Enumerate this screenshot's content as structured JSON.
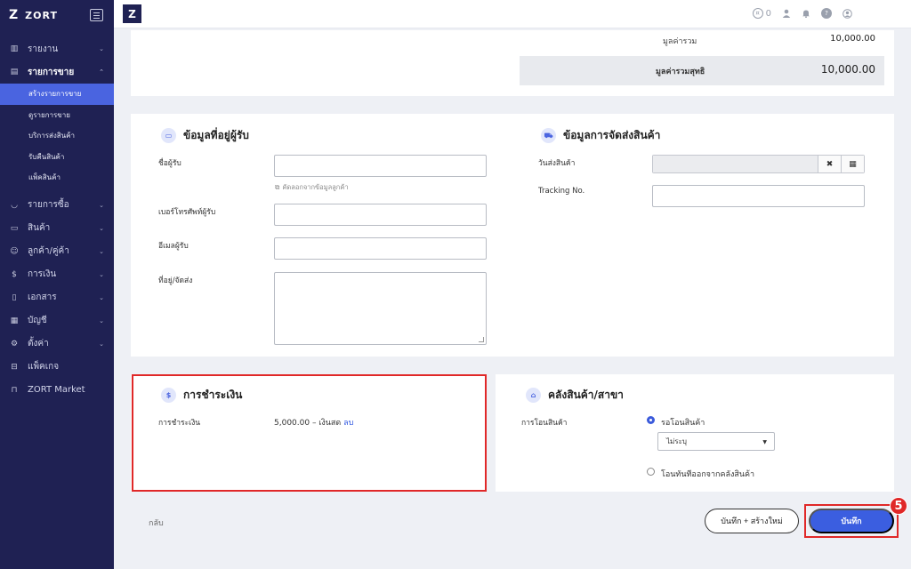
{
  "brand": {
    "logo": "Z",
    "name": "ZORT"
  },
  "sidebar": {
    "items": [
      {
        "label": "รายงาน",
        "icon": "bar-chart-icon",
        "glyph": "▥"
      },
      {
        "label": "รายการขาย",
        "icon": "clipboard-icon",
        "glyph": "▤"
      },
      {
        "label": "รายการซื้อ",
        "icon": "basket-icon",
        "glyph": "◡"
      },
      {
        "label": "สินค้า",
        "icon": "box-icon",
        "glyph": "▭"
      },
      {
        "label": "ลูกค้า/คู่ค้า",
        "icon": "users-icon",
        "glyph": "☺"
      },
      {
        "label": "การเงิน",
        "icon": "money-icon",
        "glyph": "$"
      },
      {
        "label": "เอกสาร",
        "icon": "document-icon",
        "glyph": "▯"
      },
      {
        "label": "บัญชี",
        "icon": "ledger-icon",
        "glyph": "▦"
      },
      {
        "label": "ตั้งค่า",
        "icon": "gear-icon",
        "glyph": "⚙"
      },
      {
        "label": "แพ็คเกจ",
        "icon": "briefcase-icon",
        "glyph": "⊟"
      },
      {
        "label": "ZORT Market",
        "icon": "shopping-bag-icon",
        "glyph": "⊓"
      }
    ],
    "sub_items": [
      "สร้างรายการขาย",
      "ดูรายการขาย",
      "บริการส่งสินค้า",
      "รับคืนสินค้า",
      "แพ็คสินค้า"
    ]
  },
  "topbar": {
    "logo": "Z",
    "notification_count": "0"
  },
  "summary": {
    "total_label": "มูลค่ารวม",
    "total_value": "10,000.00",
    "net_label": "มูลค่ารวมสุทธิ",
    "net_value": "10,000.00"
  },
  "recipient": {
    "title": "ข้อมูลที่อยู่ผู้รับ",
    "name_label": "ชื่อผู้รับ",
    "copy_link": "คัดลอกจากข้อมูลลูกค้า",
    "phone_label": "เบอร์โทรศัพท์ผู้รับ",
    "email_label": "อีเมลผู้รับ",
    "address_label": "ที่อยู่/จัดส่ง"
  },
  "shipping": {
    "title": "ข้อมูลการจัดส่งสินค้า",
    "date_label": "วันส่งสินค้า",
    "clear_glyph": "✖",
    "calendar_glyph": "▦",
    "tracking_label": "Tracking No."
  },
  "payment": {
    "title": "การชำระเงิน",
    "label": "การชำระเงิน",
    "value": "5,000.00 – เงินสด",
    "delete_link": "ลบ"
  },
  "warehouse": {
    "title": "คลังสินค้า/สาขา",
    "transfer_label": "การโอนสินค้า",
    "option_pending": "รอโอนสินค้า",
    "select_value": "ไม่ระบุ",
    "option_immediate": "โอนทันทีออกจากคลังสินค้า"
  },
  "footer": {
    "back": "กลับ",
    "save_new": "บันทึก + สร้างใหม่",
    "save": "บันทึก",
    "step": "5"
  },
  "colors": {
    "sidebar_bg": "#1f2153",
    "accent": "#3b5ee0",
    "highlight": "#e02828"
  }
}
